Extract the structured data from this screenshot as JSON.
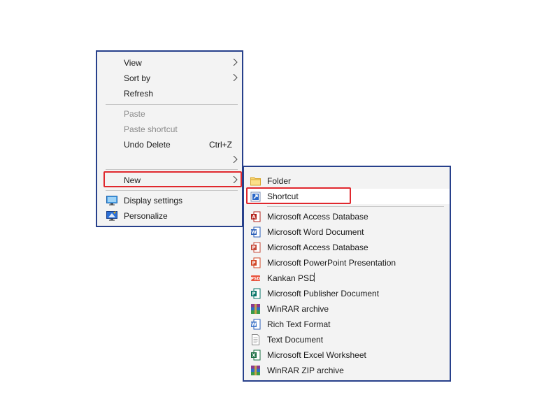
{
  "context_menu": {
    "view": "View",
    "sort_by": "Sort by",
    "refresh": "Refresh",
    "paste": "Paste",
    "paste_shortcut": "Paste shortcut",
    "undo_delete": "Undo Delete",
    "undo_delete_accel": "Ctrl+Z",
    "new": "New",
    "display_settings": "Display settings",
    "personalize": "Personalize"
  },
  "new_submenu": {
    "items": [
      {
        "label": "Folder",
        "icon": "folder-icon"
      },
      {
        "label": "Shortcut",
        "icon": "shortcut-icon"
      },
      {
        "label": "Microsoft Access Database",
        "icon": "access-icon"
      },
      {
        "label": "Microsoft Word Document",
        "icon": "word-icon"
      },
      {
        "label": "Microsoft Access Database",
        "icon": "access-icon"
      },
      {
        "label": "Microsoft PowerPoint Presentation",
        "icon": "powerpoint-icon"
      },
      {
        "label": "Kankan PSD",
        "icon": "psd-icon"
      },
      {
        "label": "Microsoft Publisher Document",
        "icon": "publisher-icon"
      },
      {
        "label": "WinRAR archive",
        "icon": "winrar-icon"
      },
      {
        "label": "Rich Text Format",
        "icon": "rtf-icon"
      },
      {
        "label": "Text Document",
        "icon": "text-document-icon"
      },
      {
        "label": "Microsoft Excel Worksheet",
        "icon": "excel-icon"
      },
      {
        "label": "WinRAR ZIP archive",
        "icon": "winrar-zip-icon"
      }
    ]
  },
  "colors": {
    "menu_border": "#27408b",
    "highlight_border": "#e0282e",
    "menu_background": "#f3f3f3"
  }
}
